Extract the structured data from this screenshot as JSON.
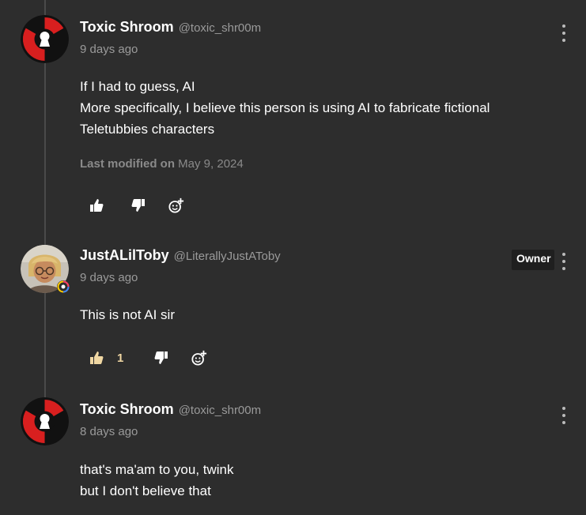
{
  "comments": [
    {
      "username": "Toxic Shroom",
      "handle": "@toxic_shr00m",
      "time": "9 days ago",
      "lines": [
        "If I had to guess, AI",
        "More specifically, I believe this person is using AI to fabricate fictional",
        "Teletubbies characters"
      ],
      "modified_label": "Last modified on",
      "modified_date": "May 9, 2024",
      "icons": [
        "thumbs-up-icon",
        "thumbs-down-icon",
        "add-reaction-icon",
        "more-options-icon"
      ]
    },
    {
      "username": "JustALilToby",
      "handle": "@LiterallyJustAToby",
      "time": "9 days ago",
      "badge": "Owner",
      "lines": [
        "This is not AI sir"
      ],
      "likes": "1",
      "icons": [
        "thumbs-up-icon",
        "thumbs-down-icon",
        "add-reaction-icon",
        "more-options-icon"
      ]
    },
    {
      "username": "Toxic Shroom",
      "handle": "@toxic_shr00m",
      "time": "8 days ago",
      "lines": [
        "that's ma'am to you, twink",
        "but I don't believe that"
      ],
      "icons": [
        "more-options-icon"
      ]
    }
  ],
  "colors": {
    "background": "#2d2d2d",
    "muted_text": "#9a9a9a",
    "liked_accent": "#f0d7a3",
    "avatar_red": "#d81f1f"
  }
}
